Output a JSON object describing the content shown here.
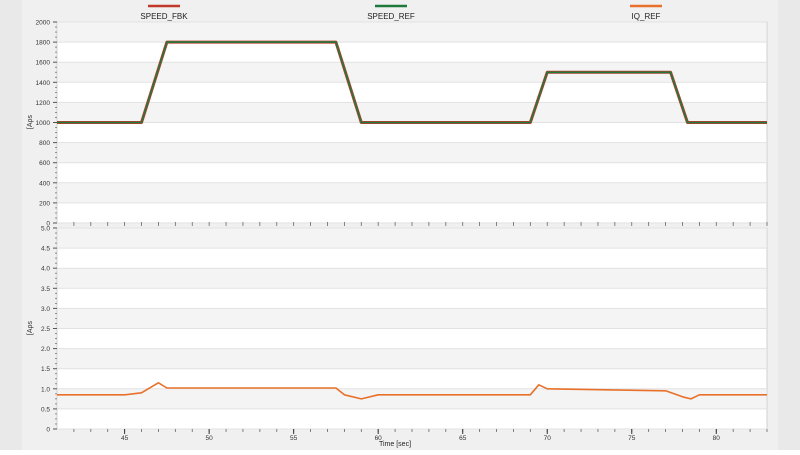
{
  "chart_data": [
    {
      "type": "line",
      "legend": "top",
      "ylabel": "[Aρs",
      "ylim": [
        0,
        2000
      ],
      "yticks": [
        0,
        200,
        400,
        600,
        800,
        1000,
        1200,
        1400,
        1600,
        1800,
        2000
      ],
      "ytick_labels": [
        "0",
        "200",
        "400",
        "600",
        "800",
        "1000",
        "1200",
        "1400",
        "1600",
        "1800",
        "2000"
      ],
      "xlim": [
        41,
        83
      ],
      "grid": true,
      "series": [
        {
          "name": "SPEED_FBK",
          "color": "#c0392b",
          "x": [
            41,
            46.0,
            47.5,
            57.5,
            59.0,
            69.0,
            70.0,
            77.3,
            78.3,
            83.0
          ],
          "y": [
            1000,
            1000,
            1800,
            1800,
            1000,
            1000,
            1500,
            1500,
            1000,
            1000
          ]
        },
        {
          "name": "SPEED_REF",
          "color": "#1e7a3c",
          "x": [
            41,
            46.0,
            47.5,
            57.5,
            59.0,
            69.0,
            70.0,
            77.3,
            78.3,
            83.0
          ],
          "y": [
            1000,
            1000,
            1800,
            1800,
            1000,
            1000,
            1500,
            1500,
            1000,
            1000
          ]
        }
      ]
    },
    {
      "type": "line",
      "ylabel": "[Aρs",
      "xlabel": "Time [sec]",
      "ylim": [
        0,
        5
      ],
      "yticks": [
        0,
        0.5,
        1,
        1.5,
        2,
        2.5,
        3,
        3.5,
        4,
        4.5,
        5
      ],
      "ytick_labels": [
        "0",
        "0.5",
        "1.0",
        "1.5",
        "2.0",
        "2.5",
        "3.0",
        "3.5",
        "4.0",
        "4.5",
        "5.0"
      ],
      "xlim": [
        41,
        83
      ],
      "xticks": [
        45,
        50,
        55,
        60,
        65,
        70,
        75,
        80
      ],
      "xtick_labels": [
        "45",
        "50",
        "55",
        "60",
        "65",
        "70",
        "75",
        "80"
      ],
      "grid": true,
      "series": [
        {
          "name": "IQ_REF",
          "color": "#e8702a",
          "x": [
            41,
            45.0,
            46.0,
            47.0,
            47.5,
            57.5,
            58.0,
            59.0,
            60.0,
            69.0,
            69.5,
            70.0,
            77.0,
            78.0,
            78.5,
            79.0,
            83.0
          ],
          "y": [
            0.85,
            0.85,
            0.9,
            1.15,
            1.02,
            1.02,
            0.85,
            0.75,
            0.85,
            0.85,
            1.1,
            1.0,
            0.95,
            0.8,
            0.75,
            0.85,
            0.85
          ]
        }
      ]
    }
  ]
}
